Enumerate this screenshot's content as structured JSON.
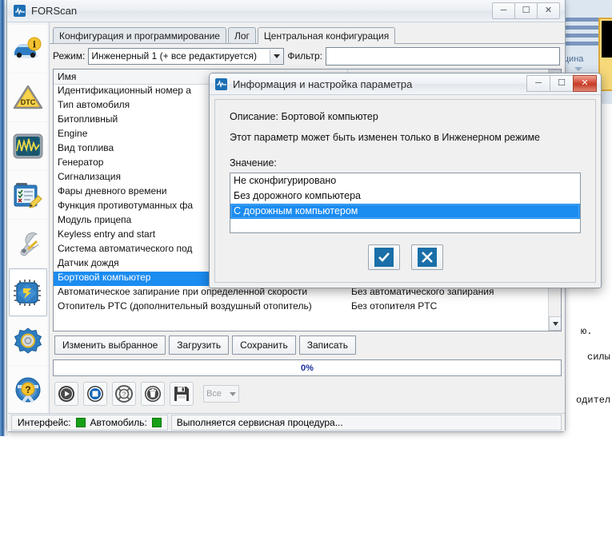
{
  "background_app": {
    "ribbon_label": "щина",
    "text_lines": [
      "ю.",
      "силы с",
      "одител"
    ]
  },
  "window": {
    "title": "FORScan",
    "icon": "waveform-icon",
    "controls": {
      "minimize": "minimize-icon",
      "maximize": "maximize-icon",
      "close": "close-icon"
    }
  },
  "sidebar": {
    "items": [
      {
        "name": "vehicle-info",
        "icon": "car-info-icon"
      },
      {
        "name": "dtc",
        "icon": "dtc-warning-icon"
      },
      {
        "name": "oscilloscope",
        "icon": "oscilloscope-icon"
      },
      {
        "name": "tests",
        "icon": "checklist-pencil-icon"
      },
      {
        "name": "service",
        "icon": "wrench-icon"
      },
      {
        "name": "configuration",
        "icon": "chip-icon"
      },
      {
        "name": "settings",
        "icon": "gear-icon"
      },
      {
        "name": "help",
        "icon": "steering-question-icon"
      }
    ],
    "active_index": 5
  },
  "tabs": [
    {
      "label": "Конфигурация и программирование",
      "active": false
    },
    {
      "label": "Лог",
      "active": false
    },
    {
      "label": "Центральная конфигурация",
      "active": true
    }
  ],
  "toolbar_row": {
    "mode_label": "Режим:",
    "mode_value": "Инженерный 1 (+ все редактируется)",
    "filter_label": "Фильтр:",
    "filter_value": "",
    "filter_placeholder": ""
  },
  "list": {
    "columns": [
      "Имя",
      ""
    ],
    "rows": [
      {
        "name": "Идентификационный номер а",
        "value": "",
        "selected": false
      },
      {
        "name": "Тип автомобиля",
        "value": "",
        "selected": false
      },
      {
        "name": "Битопливный",
        "value": "",
        "selected": false
      },
      {
        "name": "Engine",
        "value": "",
        "selected": false
      },
      {
        "name": "Вид топлива",
        "value": "",
        "selected": false
      },
      {
        "name": "Генератор",
        "value": "",
        "selected": false
      },
      {
        "name": "Сигнализация",
        "value": "",
        "selected": false
      },
      {
        "name": "Фары дневного времени",
        "value": "",
        "selected": false
      },
      {
        "name": "Функция противотуманных фа",
        "value": "",
        "selected": false
      },
      {
        "name": "Модуль прицепа",
        "value": "",
        "selected": false
      },
      {
        "name": "Keyless entry and start",
        "value": "",
        "selected": false
      },
      {
        "name": "Система автоматического под",
        "value": "",
        "selected": false
      },
      {
        "name": "Датчик дождя",
        "value": "",
        "selected": false
      },
      {
        "name": "Бортовой компьютер",
        "value": "Без дорожного компьютера",
        "selected": true
      },
      {
        "name": "Автоматическое запирание при определенной скорости",
        "value": "Без автоматического запирания",
        "selected": false
      },
      {
        "name": "Отопитель PTC (дополнительный воздушный отопитель)",
        "value": "Без отопителя PTC",
        "selected": false
      }
    ]
  },
  "actions": [
    {
      "name": "change-selected",
      "label": "Изменить выбранное"
    },
    {
      "name": "load",
      "label": "Загрузить"
    },
    {
      "name": "save",
      "label": "Сохранить"
    },
    {
      "name": "write",
      "label": "Записать"
    }
  ],
  "progress": {
    "text": "0%",
    "percent": 0
  },
  "bottom_toolbar": {
    "buttons": [
      {
        "name": "play-button",
        "icon": "play-icon"
      },
      {
        "name": "stop-button",
        "icon": "stop-icon"
      },
      {
        "name": "help-button",
        "icon": "lifebuoy-question-icon"
      },
      {
        "name": "delete-button",
        "icon": "trash-icon"
      },
      {
        "name": "save-button",
        "icon": "floppy-disk-icon"
      }
    ],
    "select_value": "Все"
  },
  "statusbar": {
    "interface_label": "Интерфейс:",
    "interface_status": "ok",
    "vehicle_label": "Автомобиль:",
    "vehicle_status": "ok",
    "message": "Выполняется сервисная процедура..."
  },
  "dialog": {
    "title": "Информация и настройка параметра",
    "icon": "waveform-icon",
    "description_label": "Описание:",
    "description_value": "Бортовой компьютер",
    "note": "Этот параметр может быть изменен только в Инженерном режиме",
    "value_label": "Значение:",
    "options": [
      {
        "label": "Не сконфигурировано",
        "selected": false
      },
      {
        "label": "Без дорожного компьютера",
        "selected": false
      },
      {
        "label": "С дорожным компьютером",
        "selected": true
      }
    ],
    "ok_button": "check-icon",
    "cancel_button": "cross-icon",
    "controls": {
      "minimize": "minimize-icon",
      "maximize": "maximize-icon",
      "close": "close-icon"
    }
  },
  "colors": {
    "selection_blue": "#1b8cf0",
    "accent_blue": "#1c6fb4",
    "status_green": "#18a018",
    "close_red": "#c43b26",
    "progress_text": "#1b2ea0"
  }
}
